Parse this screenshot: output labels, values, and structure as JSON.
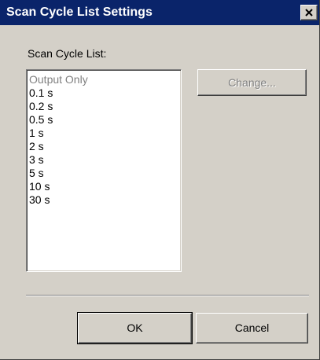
{
  "window": {
    "title": "Scan Cycle List Settings",
    "close_icon": "close-icon"
  },
  "scan_cycle": {
    "label": "Scan Cycle List:",
    "items": [
      {
        "label": "Output Only",
        "disabled": true
      },
      {
        "label": "0.1 s",
        "disabled": false
      },
      {
        "label": "0.2 s",
        "disabled": false
      },
      {
        "label": "0.5 s",
        "disabled": false
      },
      {
        "label": "1 s",
        "disabled": false
      },
      {
        "label": "2 s",
        "disabled": false
      },
      {
        "label": "3 s",
        "disabled": false
      },
      {
        "label": "5 s",
        "disabled": false
      },
      {
        "label": "10 s",
        "disabled": false
      },
      {
        "label": "30 s",
        "disabled": false
      }
    ],
    "change_label": "Change..."
  },
  "footer": {
    "ok_label": "OK",
    "cancel_label": "Cancel"
  },
  "colors": {
    "titlebar": "#0a246a",
    "face": "#d4d0c8",
    "disabled_text": "#808080"
  }
}
